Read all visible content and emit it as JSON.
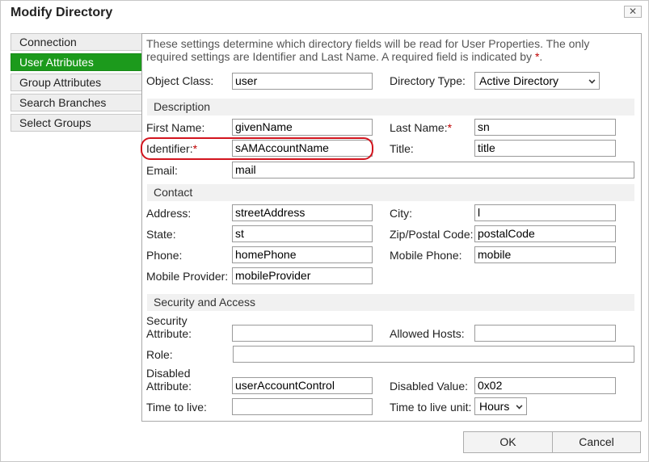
{
  "window": {
    "title": "Modify Directory",
    "close_glyph": "✕"
  },
  "sidebar": {
    "items": [
      {
        "label": "Connection"
      },
      {
        "label": "User Attributes",
        "active": true
      },
      {
        "label": "Group Attributes"
      },
      {
        "label": "Search Branches"
      },
      {
        "label": "Select Groups"
      }
    ]
  },
  "info": {
    "text": "These settings determine which directory fields will be read for User Properties. The only required settings are Identifier and Last Name. A required field is indicated by ",
    "marker": "*",
    "period": "."
  },
  "required_marker": "*",
  "fields": {
    "object_class": {
      "label": "Object Class:",
      "value": "user"
    },
    "directory_type": {
      "label": "Directory Type:",
      "value": "Active Directory"
    },
    "first_name": {
      "label": "First Name:",
      "value": "givenName"
    },
    "last_name": {
      "label": "Last Name:",
      "value": "sn"
    },
    "identifier": {
      "label": "Identifier:",
      "value": "sAMAccountName"
    },
    "title": {
      "label": "Title:",
      "value": "title"
    },
    "email": {
      "label": "Email:",
      "value": "mail"
    },
    "address": {
      "label": "Address:",
      "value": "streetAddress"
    },
    "city": {
      "label": "City:",
      "value": "l"
    },
    "state": {
      "label": "State:",
      "value": "st"
    },
    "zip": {
      "label": "Zip/Postal Code:",
      "value": "postalCode"
    },
    "phone": {
      "label": "Phone:",
      "value": "homePhone"
    },
    "mobile_phone": {
      "label": "Mobile Phone:",
      "value": "mobile"
    },
    "mobile_provider": {
      "label": "Mobile Provider:",
      "value": "mobileProvider"
    },
    "security_attribute": {
      "label_line1": "Security",
      "label_line2": "Attribute:",
      "value": ""
    },
    "allowed_hosts": {
      "label": "Allowed Hosts:",
      "value": ""
    },
    "role": {
      "label": "Role:",
      "value": ""
    },
    "disabled_attribute": {
      "label_line1": "Disabled",
      "label_line2": "Attribute:",
      "value": "userAccountControl"
    },
    "disabled_value": {
      "label": "Disabled Value:",
      "value": "0x02"
    },
    "time_to_live": {
      "label": "Time to live:",
      "value": ""
    },
    "time_to_live_unit": {
      "label": "Time to live unit:",
      "value": "Hours"
    }
  },
  "sections": {
    "description": "Description",
    "contact": "Contact",
    "security": "Security and Access"
  },
  "buttons": {
    "ok": "OK",
    "cancel": "Cancel"
  },
  "colors": {
    "active_tab": "#1c9a1c",
    "required": "#c00000",
    "annotation": "#d2141e"
  }
}
